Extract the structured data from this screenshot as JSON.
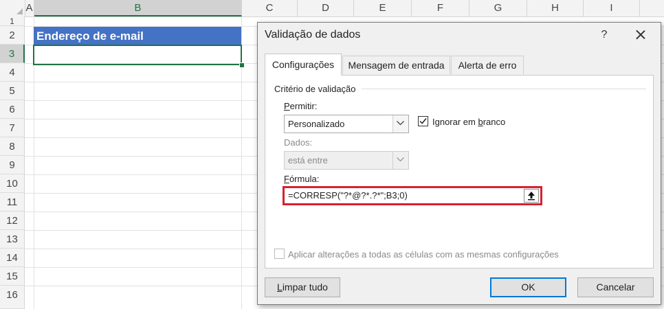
{
  "sheet": {
    "columns": [
      "A",
      "B",
      "C",
      "D",
      "E",
      "F",
      "G",
      "H",
      "I"
    ],
    "rows": [
      "1",
      "2",
      "3",
      "4",
      "5",
      "6",
      "7",
      "8",
      "9",
      "10",
      "11",
      "12",
      "13",
      "14",
      "15",
      "16"
    ],
    "selected_column": "B",
    "selected_row": "3",
    "header_cell_text": "Endereço de e-mail",
    "header_fill_color": "#4472c4",
    "selection_color": "#217346"
  },
  "dialog": {
    "title": "Validação de dados",
    "help_label": "?",
    "tabs": [
      {
        "label": "Configurações",
        "active": true
      },
      {
        "label": "Mensagem de entrada",
        "active": false
      },
      {
        "label": "Alerta de erro",
        "active": false
      }
    ],
    "criteria_group_title": "Critério de validação",
    "allow": {
      "label_mnemonic": "P",
      "label_rest": "ermitir:",
      "value": "Personalizado"
    },
    "ignore_blank": {
      "label_before": "Ignorar em ",
      "label_mnemonic": "b",
      "label_after": "ranco",
      "checked": true
    },
    "data": {
      "label": "Dados:",
      "value": "está entre",
      "enabled": false
    },
    "formula": {
      "label_mnemonic": "F",
      "label_rest": "órmula:",
      "value": "=CORRESP(\"?*@?*.?*\";B3;0)",
      "highlight_color": "#d6212f"
    },
    "apply_all": {
      "label": "Aplicar alterações a todas as células com as mesmas configurações",
      "checked": false,
      "enabled": false
    },
    "buttons": {
      "clear_mnemonic": "L",
      "clear_rest": "impar tudo",
      "ok": "OK",
      "cancel": "Cancelar"
    },
    "icons": [
      "close-icon",
      "dropdown-arrow-icon",
      "checkmark-icon",
      "collapse-dialog-icon"
    ]
  }
}
